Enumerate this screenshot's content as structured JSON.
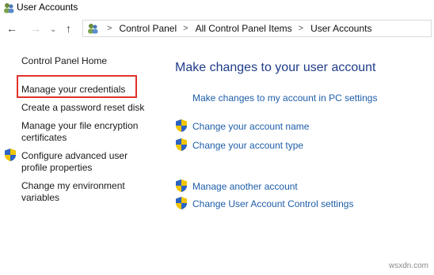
{
  "window": {
    "title": "User Accounts"
  },
  "nav": {
    "back": "←",
    "forward": "→",
    "recent": "⌄",
    "up": "↑",
    "breadcrumb": [
      "Control Panel",
      "All Control Panel Items",
      "User Accounts"
    ],
    "separator": ">"
  },
  "sidebar": {
    "home": "Control Panel Home",
    "items": [
      {
        "lines": [
          "Manage your credentials"
        ]
      },
      {
        "lines": [
          "Create a password reset disk"
        ]
      },
      {
        "lines": [
          "Manage your file encryption",
          "certificates"
        ]
      },
      {
        "lines": [
          "Configure advanced user",
          "profile properties"
        ],
        "icon": "uac-shield-icon"
      },
      {
        "lines": [
          "Change my environment",
          "variables"
        ]
      }
    ]
  },
  "main": {
    "title": "Make changes to your user account",
    "pc_settings_link": "Make changes to my account in PC settings",
    "tasks": [
      {
        "label": "Change your account name",
        "icon": "uac-shield-icon"
      },
      {
        "label": "Change your account type",
        "icon": "uac-shield-icon"
      },
      {
        "label": "Manage another account",
        "icon": "uac-shield-icon"
      },
      {
        "label": "Change User Account Control settings",
        "icon": "uac-shield-icon"
      }
    ]
  },
  "watermark": "wsxdn.com",
  "colors": {
    "main_title": "#1e3c87",
    "link": "#1e5ea8",
    "highlight": "#e0322c"
  }
}
